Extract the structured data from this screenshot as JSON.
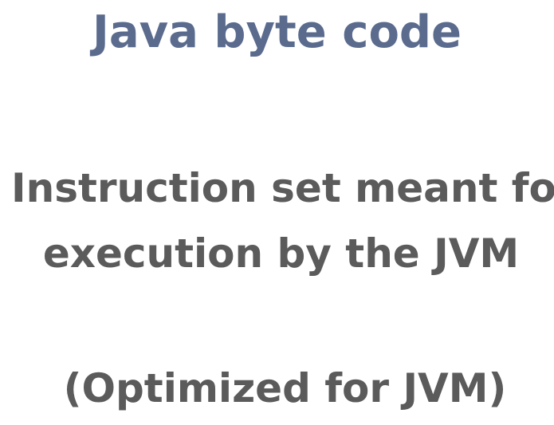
{
  "slide": {
    "title": "Java byte code",
    "body_lines": [
      "Instruction set meant for",
      "execution by the JVM"
    ],
    "note": "(Optimized for JVM)"
  },
  "colors": {
    "title": "#5a6b8e",
    "body": "#5b5b5b",
    "background": "#ffffff"
  }
}
